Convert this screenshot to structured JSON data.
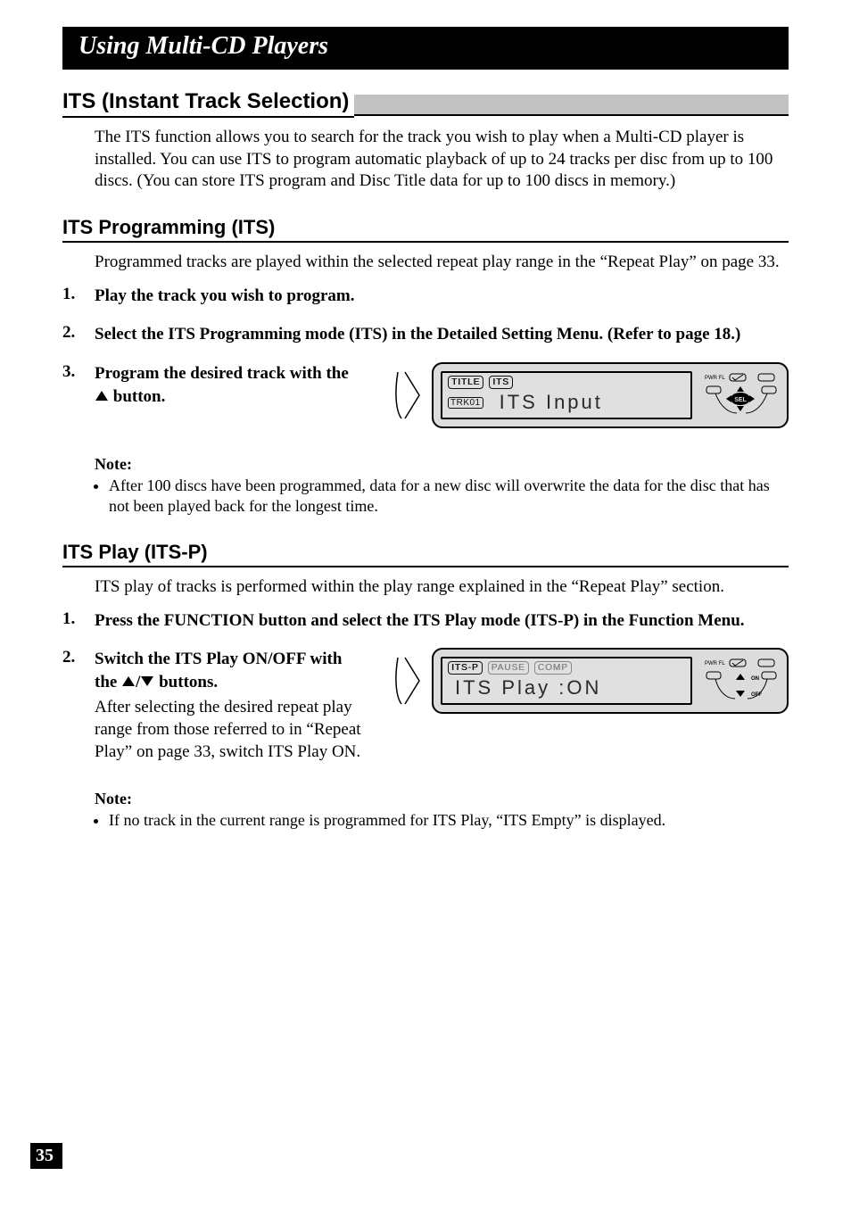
{
  "chapter_title": "Using Multi-CD Players",
  "section1": {
    "title": "ITS (Instant Track Selection)",
    "intro": "The ITS function allows you to search for the track you wish to play when a Multi-CD player is installed. You can use ITS to program automatic playback of up to 24 tracks per disc from up to 100 discs. (You can store ITS program and Disc Title data for up to 100 discs in memory.)"
  },
  "section2": {
    "title": "ITS Programming (ITS)",
    "intro": "Programmed tracks are played within the selected repeat play range in the “Repeat Play” on page 33.",
    "step1": "Play the track you wish to program.",
    "step2": "Select the ITS Programming mode (ITS) in the Detailed Setting Menu. (Refer to page 18.)",
    "step3a": "Program the desired track with the ",
    "step3b": " button.",
    "note_title": "Note:",
    "note1": "After 100 discs have been programmed, data for a new disc will overwrite the data for the disc that has not been played back for the longest time."
  },
  "section3": {
    "title": "ITS Play (ITS-P)",
    "intro": "ITS play of tracks is performed within the play range explained in the “Repeat Play” section.",
    "step1": "Press the FUNCTION button and select the ITS Play mode (ITS-P) in the Function Menu.",
    "step2a": "Switch the ITS Play ON/OFF with the ",
    "step2b": " buttons.",
    "step2_sub": "After selecting the desired repeat play range from those referred to in “Repeat Play” on page 33, switch ITS Play ON.",
    "note_title": "Note:",
    "note1": "If no track in the current range is programmed for ITS Play, “ITS Empty” is displayed."
  },
  "lcd1": {
    "title_badge": "TITLE",
    "its_badge": "ITS",
    "trk_badge": "TRK",
    "trk_num": "01",
    "main_text": "ITS Input",
    "pwr_label": "PWR FL"
  },
  "lcd2": {
    "itsp_badge": "ITS-P",
    "pause_badge": "PAUSE",
    "comp_badge": "COMP",
    "main_text": "ITS Play :ON",
    "pwr_label": "PWR FL",
    "on_label": "ON",
    "off_label": "OFF"
  },
  "page_number": "35"
}
